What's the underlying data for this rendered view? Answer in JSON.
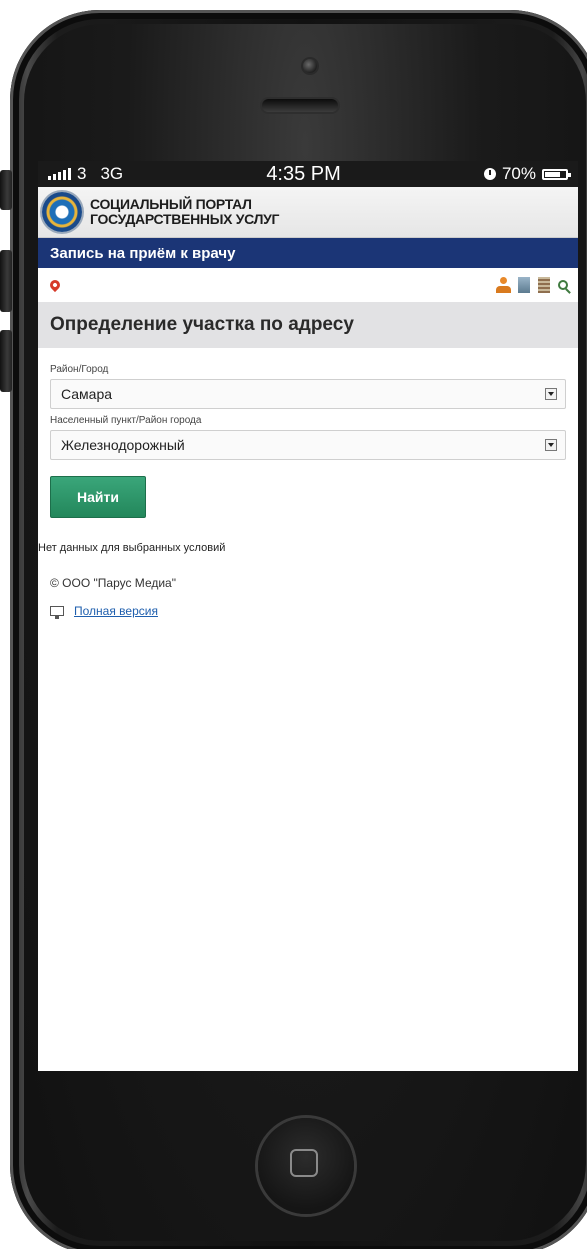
{
  "statusbar": {
    "carrier": "3",
    "network": "3G",
    "time": "4:35 PM",
    "battery": "70%"
  },
  "portal": {
    "name_line1": "СОЦИАЛЬНЫЙ ПОРТАЛ",
    "name_line2": "ГОСУДАРСТВЕННЫХ УСЛУГ"
  },
  "titlebar": {
    "title": "Запись на приём к врачу"
  },
  "icons": {
    "left": "map-pin-icon",
    "right": [
      "person-icon",
      "building-icon",
      "document-icon",
      "search-icon"
    ]
  },
  "section": {
    "title": "Определение участка по адресу"
  },
  "form": {
    "district_label": "Район/Город",
    "district_value": "Самара",
    "locality_label": "Населенный пункт/Район города",
    "locality_value": "Железнодорожный",
    "find_label": "Найти"
  },
  "message": {
    "no_data": "Нет данных для выбранных условий"
  },
  "footer": {
    "copyright": "© ООО \"Парус Медиа\"",
    "full_version": "Полная версия"
  },
  "colors": {
    "title_bar": "#1b3576",
    "find_button": "#2a9568",
    "link": "#1f5fae"
  }
}
